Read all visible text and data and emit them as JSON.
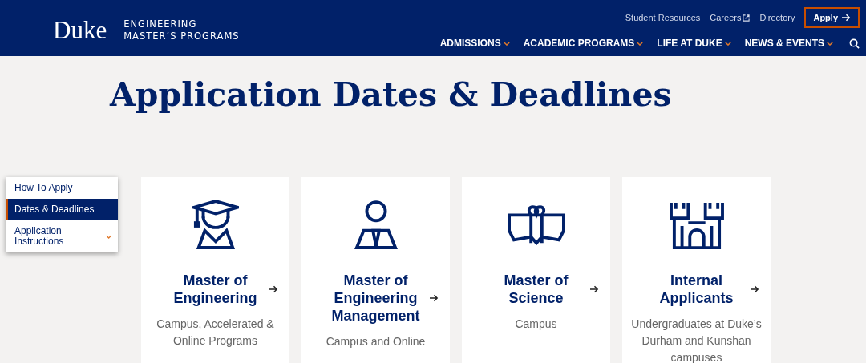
{
  "header": {
    "logo": "Duke",
    "subtitle_lines": [
      "ENGINEERING",
      "MASTER’S PROGRAMS"
    ],
    "utility_links": [
      {
        "label": "Student Resources",
        "external": false
      },
      {
        "label": "Careers",
        "external": true
      },
      {
        "label": "Directory",
        "external": false
      }
    ],
    "apply_button": "Apply",
    "nav": [
      {
        "label": "ADMISSIONS"
      },
      {
        "label": "ACADEMIC PROGRAMS"
      },
      {
        "label": "LIFE AT DUKE"
      },
      {
        "label": "NEWS & EVENTS"
      }
    ]
  },
  "page_title": "Application Dates & Deadlines",
  "side_nav": [
    {
      "label": "How To Apply",
      "selected": false,
      "has_submenu": false
    },
    {
      "label": "Dates & Deadlines",
      "selected": true,
      "has_submenu": false
    },
    {
      "label": "Application Instructions",
      "selected": false,
      "has_submenu": true
    }
  ],
  "cards": [
    {
      "kind": "graduate",
      "title": "Master of Engineering",
      "description": "Campus, Accelerated & Online Programs"
    },
    {
      "kind": "professional",
      "title": "Master of Engineering Management",
      "description": "Campus and Online"
    },
    {
      "kind": "book",
      "title": "Master of Science",
      "description": "Campus"
    },
    {
      "kind": "castle",
      "title": "Internal Applicants",
      "description": "Undergraduates at Duke’s Durham and Kunshan campuses"
    }
  ]
}
